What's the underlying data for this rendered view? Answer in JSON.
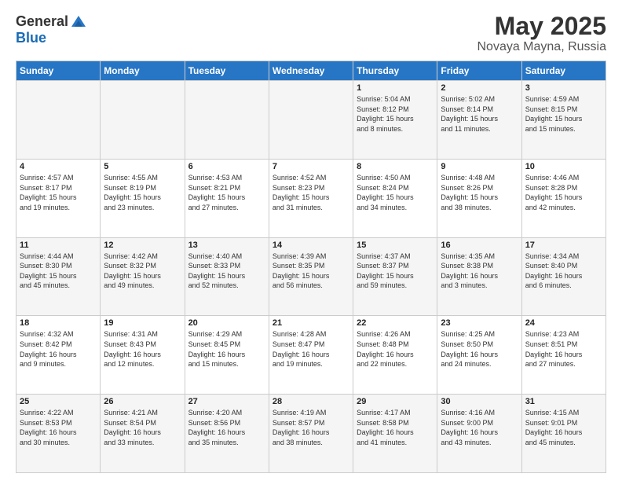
{
  "header": {
    "logo_general": "General",
    "logo_blue": "Blue",
    "title": "May 2025",
    "subtitle": "Novaya Mayna, Russia"
  },
  "days_of_week": [
    "Sunday",
    "Monday",
    "Tuesday",
    "Wednesday",
    "Thursday",
    "Friday",
    "Saturday"
  ],
  "weeks": [
    [
      {
        "day": "",
        "info": ""
      },
      {
        "day": "",
        "info": ""
      },
      {
        "day": "",
        "info": ""
      },
      {
        "day": "",
        "info": ""
      },
      {
        "day": "1",
        "info": "Sunrise: 5:04 AM\nSunset: 8:12 PM\nDaylight: 15 hours\nand 8 minutes."
      },
      {
        "day": "2",
        "info": "Sunrise: 5:02 AM\nSunset: 8:14 PM\nDaylight: 15 hours\nand 11 minutes."
      },
      {
        "day": "3",
        "info": "Sunrise: 4:59 AM\nSunset: 8:15 PM\nDaylight: 15 hours\nand 15 minutes."
      }
    ],
    [
      {
        "day": "4",
        "info": "Sunrise: 4:57 AM\nSunset: 8:17 PM\nDaylight: 15 hours\nand 19 minutes."
      },
      {
        "day": "5",
        "info": "Sunrise: 4:55 AM\nSunset: 8:19 PM\nDaylight: 15 hours\nand 23 minutes."
      },
      {
        "day": "6",
        "info": "Sunrise: 4:53 AM\nSunset: 8:21 PM\nDaylight: 15 hours\nand 27 minutes."
      },
      {
        "day": "7",
        "info": "Sunrise: 4:52 AM\nSunset: 8:23 PM\nDaylight: 15 hours\nand 31 minutes."
      },
      {
        "day": "8",
        "info": "Sunrise: 4:50 AM\nSunset: 8:24 PM\nDaylight: 15 hours\nand 34 minutes."
      },
      {
        "day": "9",
        "info": "Sunrise: 4:48 AM\nSunset: 8:26 PM\nDaylight: 15 hours\nand 38 minutes."
      },
      {
        "day": "10",
        "info": "Sunrise: 4:46 AM\nSunset: 8:28 PM\nDaylight: 15 hours\nand 42 minutes."
      }
    ],
    [
      {
        "day": "11",
        "info": "Sunrise: 4:44 AM\nSunset: 8:30 PM\nDaylight: 15 hours\nand 45 minutes."
      },
      {
        "day": "12",
        "info": "Sunrise: 4:42 AM\nSunset: 8:32 PM\nDaylight: 15 hours\nand 49 minutes."
      },
      {
        "day": "13",
        "info": "Sunrise: 4:40 AM\nSunset: 8:33 PM\nDaylight: 15 hours\nand 52 minutes."
      },
      {
        "day": "14",
        "info": "Sunrise: 4:39 AM\nSunset: 8:35 PM\nDaylight: 15 hours\nand 56 minutes."
      },
      {
        "day": "15",
        "info": "Sunrise: 4:37 AM\nSunset: 8:37 PM\nDaylight: 15 hours\nand 59 minutes."
      },
      {
        "day": "16",
        "info": "Sunrise: 4:35 AM\nSunset: 8:38 PM\nDaylight: 16 hours\nand 3 minutes."
      },
      {
        "day": "17",
        "info": "Sunrise: 4:34 AM\nSunset: 8:40 PM\nDaylight: 16 hours\nand 6 minutes."
      }
    ],
    [
      {
        "day": "18",
        "info": "Sunrise: 4:32 AM\nSunset: 8:42 PM\nDaylight: 16 hours\nand 9 minutes."
      },
      {
        "day": "19",
        "info": "Sunrise: 4:31 AM\nSunset: 8:43 PM\nDaylight: 16 hours\nand 12 minutes."
      },
      {
        "day": "20",
        "info": "Sunrise: 4:29 AM\nSunset: 8:45 PM\nDaylight: 16 hours\nand 15 minutes."
      },
      {
        "day": "21",
        "info": "Sunrise: 4:28 AM\nSunset: 8:47 PM\nDaylight: 16 hours\nand 19 minutes."
      },
      {
        "day": "22",
        "info": "Sunrise: 4:26 AM\nSunset: 8:48 PM\nDaylight: 16 hours\nand 22 minutes."
      },
      {
        "day": "23",
        "info": "Sunrise: 4:25 AM\nSunset: 8:50 PM\nDaylight: 16 hours\nand 24 minutes."
      },
      {
        "day": "24",
        "info": "Sunrise: 4:23 AM\nSunset: 8:51 PM\nDaylight: 16 hours\nand 27 minutes."
      }
    ],
    [
      {
        "day": "25",
        "info": "Sunrise: 4:22 AM\nSunset: 8:53 PM\nDaylight: 16 hours\nand 30 minutes."
      },
      {
        "day": "26",
        "info": "Sunrise: 4:21 AM\nSunset: 8:54 PM\nDaylight: 16 hours\nand 33 minutes."
      },
      {
        "day": "27",
        "info": "Sunrise: 4:20 AM\nSunset: 8:56 PM\nDaylight: 16 hours\nand 35 minutes."
      },
      {
        "day": "28",
        "info": "Sunrise: 4:19 AM\nSunset: 8:57 PM\nDaylight: 16 hours\nand 38 minutes."
      },
      {
        "day": "29",
        "info": "Sunrise: 4:17 AM\nSunset: 8:58 PM\nDaylight: 16 hours\nand 41 minutes."
      },
      {
        "day": "30",
        "info": "Sunrise: 4:16 AM\nSunset: 9:00 PM\nDaylight: 16 hours\nand 43 minutes."
      },
      {
        "day": "31",
        "info": "Sunrise: 4:15 AM\nSunset: 9:01 PM\nDaylight: 16 hours\nand 45 minutes."
      }
    ]
  ]
}
